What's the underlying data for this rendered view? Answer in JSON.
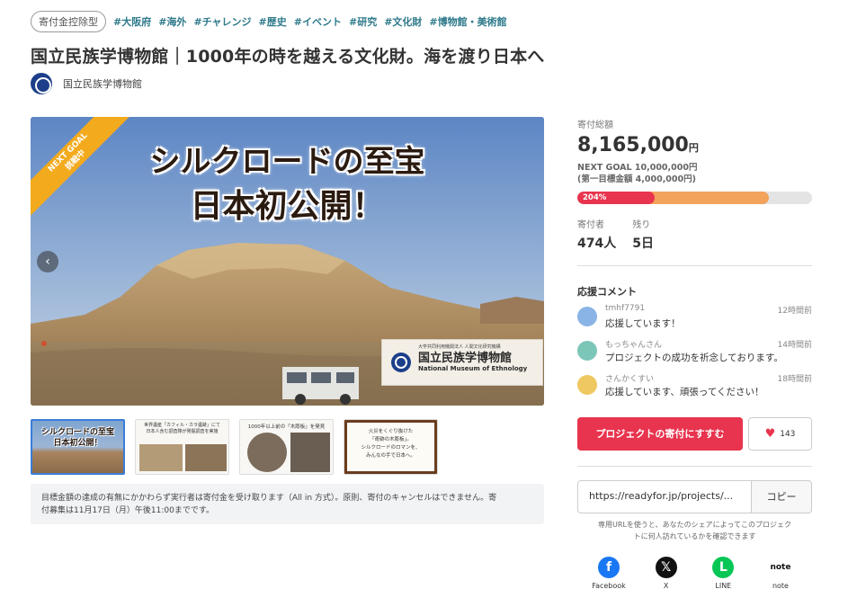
{
  "header": {
    "badge": "寄付金控除型",
    "tags": [
      "#大阪府",
      "#海外",
      "#チャレンジ",
      "#歴史",
      "#イベント",
      "#研究",
      "#文化財",
      "#博物館・美術館"
    ],
    "title": "国立民族学博物館｜1000年の時を越える文化財。海を渡り日本へ",
    "owner": "国立民族学博物館"
  },
  "hero": {
    "ribbon_line1": "NEXT GOAL",
    "ribbon_line2": "挑戦中",
    "headline1": "シルクロードの至宝",
    "headline2": "日本初公開！",
    "museum_sub": "大学共同利用機関法人 人間文化研究機構",
    "museum_jp": "国立民族学博物館",
    "museum_en": "National Museum of Ethnology",
    "prev_arrow": "‹",
    "next_arrow": "›"
  },
  "thumbnails": [
    {
      "line1": "シルクロードの至宝",
      "line2": "日本初公開！"
    },
    {
      "line1": "世界遺産「カフィル・カラ遺跡」にて",
      "line2": "日本人含む調査隊が発掘調査を実施"
    },
    {
      "line1": "1000年以上前の「木彫板」を発見"
    },
    {
      "line1": "火災をくぐり抜けた",
      "line2": "「奇跡の木彫板」。",
      "line3": "シルクロードのロマンを、",
      "line4": "みんなの手で日本へ。"
    }
  ],
  "notice": {
    "text1": "目標金額の達成の有無にかかわらず実行者は寄付金を受け取ります（All in 方式）。原則、寄付のキャンセルはできません。寄",
    "text2": "付募集は11月17日（月）午後11:00までです。"
  },
  "funding": {
    "total_label": "寄付総額",
    "amount": "8,165,000",
    "unit": "円",
    "next_goal": "NEXT GOAL 10,000,000円",
    "first_goal": "(第一目標金額 4,000,000円)",
    "percent_label": "204%",
    "progress_first": 0.33,
    "progress_next": 0.816,
    "supporters_label": "寄付者",
    "supporters": "474人",
    "remaining_label": "残り",
    "remaining": "5日"
  },
  "comments": {
    "title": "応援コメント",
    "items": [
      {
        "name": "tmhf7791",
        "time": "12時間前",
        "text": "応援しています！",
        "avatar_color": "#8ab4e6"
      },
      {
        "name": "もっちゃんさん",
        "time": "14時間前",
        "text": "プロジェクトの成功を祈念しております。",
        "avatar_color": "#7cc6b8"
      },
      {
        "name": "さんかくすい",
        "time": "18時間前",
        "text": "応援しています、頑張ってください！",
        "avatar_color": "#f0c862"
      }
    ]
  },
  "actions": {
    "cta": "プロジェクトの寄付にすすむ",
    "like_count": "143",
    "share_url": "https://readyfor.jp/projects/...",
    "copy": "コピー",
    "share_note1": "専用URLを使うと、あなたのシェアによってこのプロジェク",
    "share_note2": "トに何人訪れているかを確認できます"
  },
  "social": [
    {
      "name": "Facebook",
      "icon": "facebook-icon",
      "glyph": "f",
      "color": "#1877f2"
    },
    {
      "name": "X",
      "icon": "x-icon",
      "glyph": "𝕏",
      "color": "#111111"
    },
    {
      "name": "LINE",
      "icon": "line-icon",
      "glyph": "L",
      "color": "#06c755"
    },
    {
      "name": "note",
      "icon": "note-icon",
      "glyph": "note",
      "color": "#ffffff"
    }
  ]
}
